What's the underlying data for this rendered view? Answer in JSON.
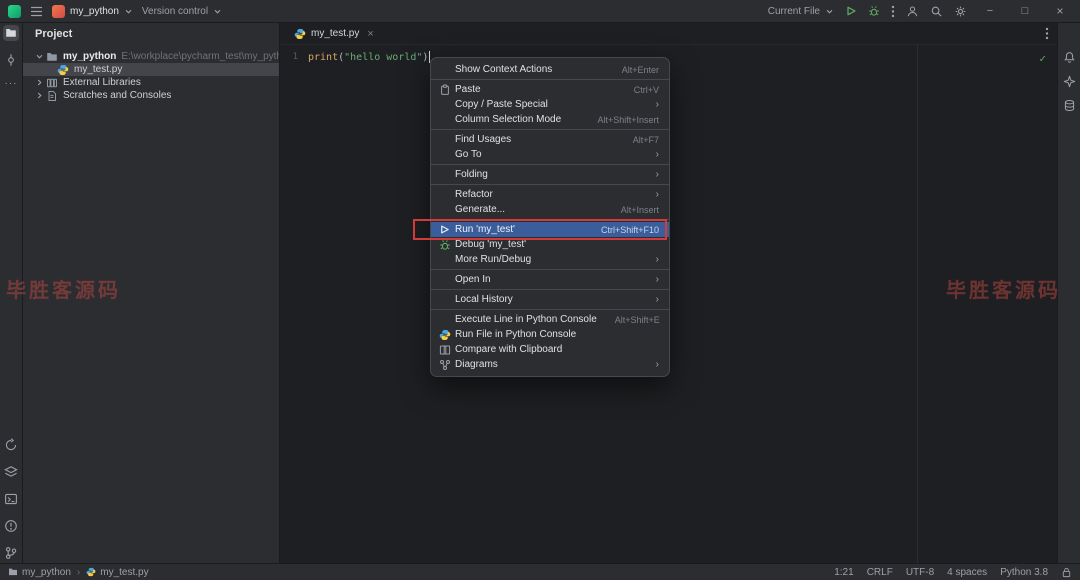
{
  "colors": {
    "selection_blue": "#3a5e9b",
    "annotation_red": "#d23b3b",
    "run_green": "#5fad65",
    "string_green": "#6aab73",
    "function_yellow": "#d5a662",
    "panel_bg": "#2b2d30",
    "editor_bg": "#1e1f22"
  },
  "icons": {
    "close": "×",
    "minimize": "−",
    "maximize": "□",
    "check": "✓",
    "submenu_arrow": "›",
    "breadcrumb_sep": "›",
    "more": "···"
  },
  "titlebar": {
    "project_name": "my_python",
    "version_control": "Version control",
    "run_config": "Current File"
  },
  "project_panel": {
    "title": "Project",
    "tree": [
      {
        "label": "my_python",
        "hint": "E:\\workplace\\pycharm_test\\my_python",
        "icon": "folder",
        "chevron": "down",
        "indent": 0,
        "bold": true,
        "selected": false
      },
      {
        "label": "my_test.py",
        "icon": "python",
        "chevron": "none",
        "indent": 1,
        "bold": false,
        "selected": true
      },
      {
        "label": "External Libraries",
        "icon": "libraries",
        "chevron": "right",
        "indent": 0,
        "bold": false,
        "selected": false
      },
      {
        "label": "Scratches and Consoles",
        "icon": "scratches",
        "chevron": "right",
        "indent": 0,
        "bold": false,
        "selected": false
      }
    ]
  },
  "editor": {
    "tab_label": "my_test.py",
    "line_number": "1",
    "code_tokens": [
      {
        "text": "print",
        "type": "function"
      },
      {
        "text": "(",
        "type": "paren"
      },
      {
        "text": "\"hello world\"",
        "type": "string"
      },
      {
        "text": ")",
        "type": "paren"
      }
    ]
  },
  "context_menu": {
    "items": [
      {
        "label": "Show Context Actions",
        "shortcut": "Alt+Enter"
      },
      {
        "separator": true
      },
      {
        "label": "Paste",
        "shortcut": "Ctrl+V",
        "icon": "paste"
      },
      {
        "label": "Copy / Paste Special",
        "submenu": true
      },
      {
        "label": "Column Selection Mode",
        "shortcut": "Alt+Shift+Insert"
      },
      {
        "separator": true
      },
      {
        "label": "Find Usages",
        "shortcut": "Alt+F7"
      },
      {
        "label": "Go To",
        "submenu": true
      },
      {
        "separator": true
      },
      {
        "label": "Folding",
        "submenu": true
      },
      {
        "separator": true
      },
      {
        "label": "Refactor",
        "submenu": true
      },
      {
        "label": "Generate...",
        "shortcut": "Alt+Insert"
      },
      {
        "separator": true
      },
      {
        "label": "Run 'my_test'",
        "shortcut": "Ctrl+Shift+F10",
        "icon": "run",
        "selected": true
      },
      {
        "label": "Debug 'my_test'",
        "icon": "debug"
      },
      {
        "label": "More Run/Debug",
        "submenu": true
      },
      {
        "separator": true
      },
      {
        "label": "Open In",
        "submenu": true
      },
      {
        "separator": true
      },
      {
        "label": "Local History",
        "submenu": true
      },
      {
        "separator": true
      },
      {
        "label": "Execute Line in Python Console",
        "shortcut": "Alt+Shift+E"
      },
      {
        "label": "Run File in Python Console",
        "icon": "python"
      },
      {
        "label": "Compare with Clipboard",
        "icon": "compare"
      },
      {
        "label": "Diagrams",
        "submenu": true,
        "icon": "diagram"
      }
    ]
  },
  "status_bar": {
    "breadcrumbs": [
      {
        "label": "my_python",
        "icon": "folder"
      },
      {
        "label": "my_test.py",
        "icon": "python"
      }
    ],
    "segments": [
      "1:21",
      "CRLF",
      "UTF-8",
      "4 spaces",
      "Python 3.8"
    ]
  },
  "watermark": {
    "text": "毕胜客源码"
  }
}
